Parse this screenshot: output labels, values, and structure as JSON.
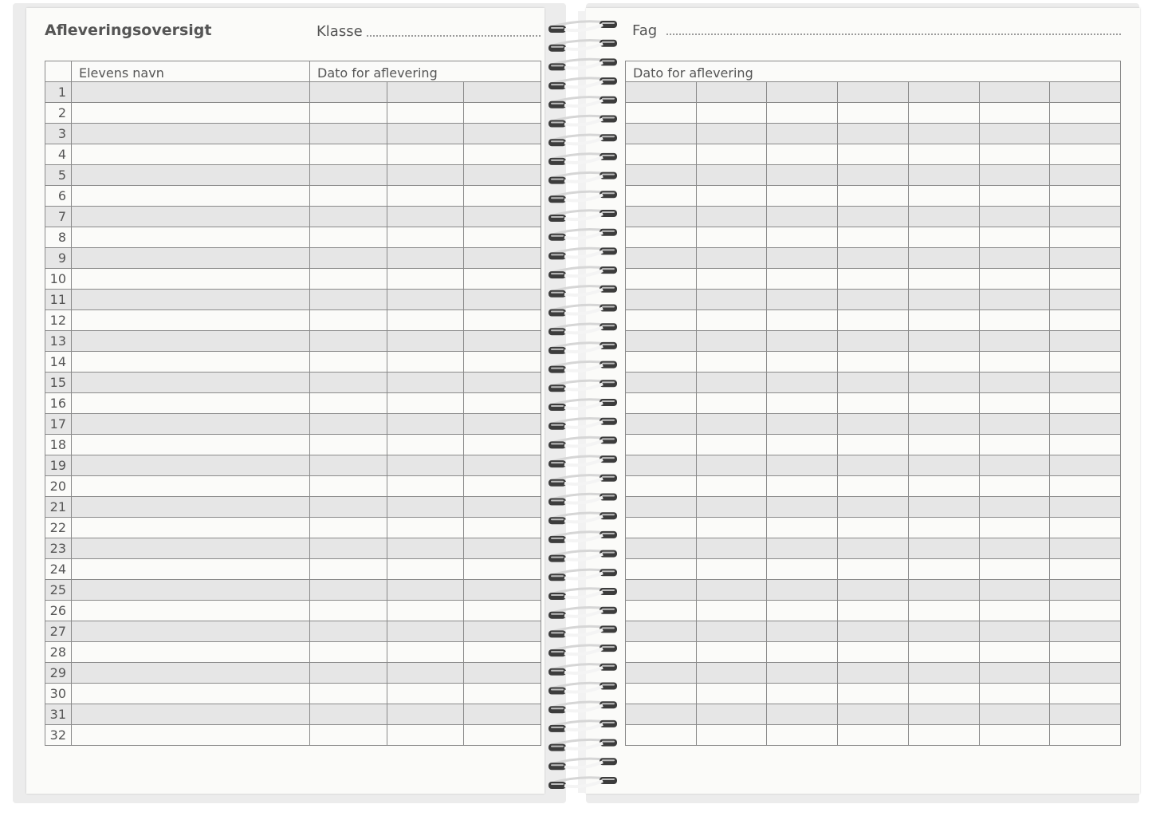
{
  "left_page": {
    "title": "Afleveringsoversigt",
    "class_label": "Klasse",
    "headers": {
      "corner": "",
      "student_name": "Elevens navn",
      "date": "Dato for aflevering"
    },
    "row_numbers": [
      "1",
      "2",
      "3",
      "4",
      "5",
      "6",
      "7",
      "8",
      "9",
      "10",
      "11",
      "12",
      "13",
      "14",
      "15",
      "16",
      "17",
      "18",
      "19",
      "20",
      "21",
      "22",
      "23",
      "24",
      "25",
      "26",
      "27",
      "28",
      "29",
      "30",
      "31",
      "32"
    ],
    "date_columns": 3
  },
  "right_page": {
    "subject_label": "Fag",
    "headers": {
      "date": "Dato for aflevering"
    },
    "date_columns": 7
  },
  "colors": {
    "shaded_row": "#e6e6e6",
    "paper": "#fbfbf9",
    "grid_line": "#8a8a8a",
    "text": "#555555"
  },
  "binding": {
    "type": "spiral-wire",
    "icon": "spiral-binding-icon"
  }
}
